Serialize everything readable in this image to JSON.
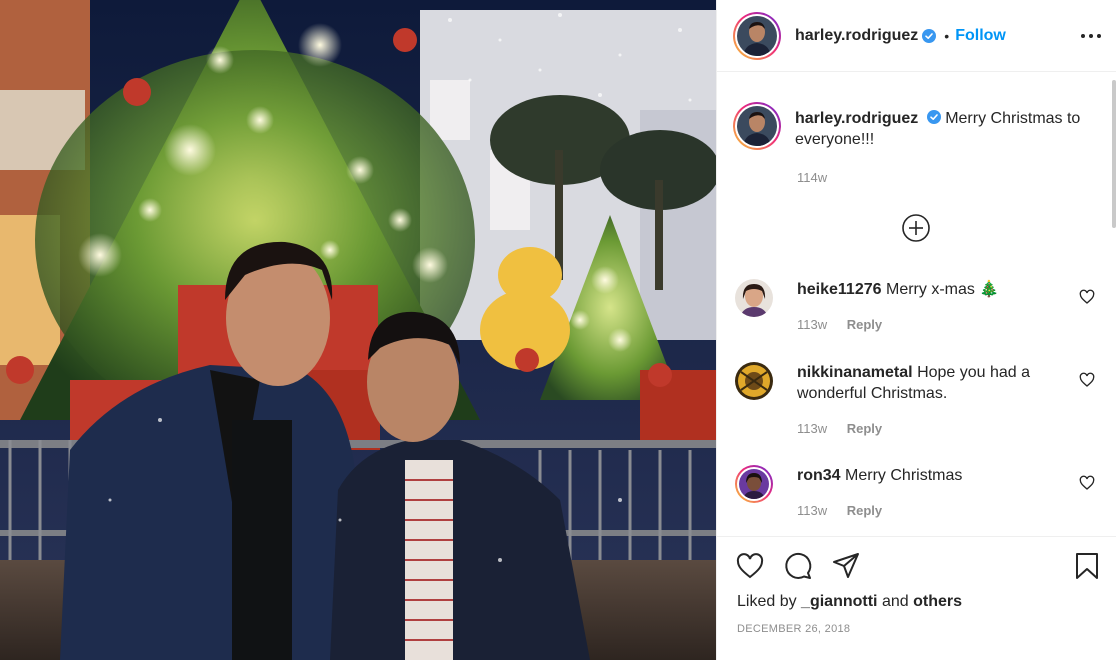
{
  "post": {
    "username": "harley.rodriguez",
    "follow_label": "Follow",
    "separator": "•",
    "caption": "Merry Christmas to everyone!!!",
    "caption_time": "114w",
    "liked_by_prefix": "Liked by",
    "liked_by_user": "_giannotti",
    "liked_by_and": "and",
    "liked_by_others": "others",
    "date": "DECEMBER 26, 2018"
  },
  "comments": [
    {
      "username": "heike11276",
      "text": "Merry x-mas 🎄",
      "time": "113w",
      "reply_label": "Reply"
    },
    {
      "username": "nikkinanametal",
      "text": "Hope you had a wonderful Christmas.",
      "time": "113w",
      "reply_label": "Reply"
    },
    {
      "username": "ron34",
      "text": "Merry Christmas",
      "time": "113w",
      "reply_label": "Reply"
    }
  ],
  "colors": {
    "accent": "#0095f6",
    "verified": "#3897f0",
    "muted": "#8e8e8e",
    "text": "#262626"
  },
  "icons": {
    "more": "ellipsis-icon",
    "load_more": "plus-circle-icon",
    "like": "heart-icon",
    "comment": "comment-bubble-icon",
    "share": "paper-plane-icon",
    "save": "bookmark-icon"
  }
}
